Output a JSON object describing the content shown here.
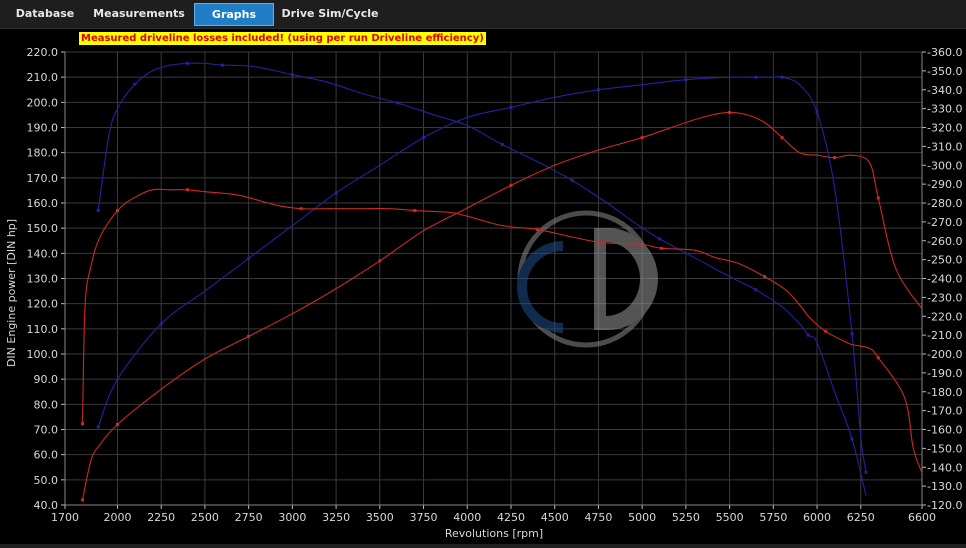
{
  "tabs": [
    {
      "label": "Database",
      "active": false
    },
    {
      "label": "Measurements",
      "active": false
    },
    {
      "label": "Graphs",
      "active": true
    },
    {
      "label": "Drive Sim/Cycle",
      "active": false
    }
  ],
  "banner": "Measured driveline losses included! (using per run Driveline efficiency)",
  "colors": {
    "blue": "#2323a0",
    "red": "#cc2a22",
    "grid": "#3a3a3a",
    "text": "#d8d8d8",
    "accent": "#1f7ec6"
  },
  "chart_data": {
    "type": "line",
    "xlabel": "Revolutions [rpm]",
    "ylabel": "DIN Engine power [DIN hp]",
    "xlim": [
      1700,
      6600
    ],
    "ylim": [
      40,
      220
    ],
    "y2lim": [
      120,
      360
    ],
    "grid": true,
    "x_tick_labels": [
      "1700",
      "2000",
      "2250",
      "2500",
      "2750",
      "3000",
      "3250",
      "3500",
      "3750",
      "4000",
      "4250",
      "4500",
      "4750",
      "5000",
      "5250",
      "5500",
      "5750",
      "6000",
      "6250",
      "6600"
    ],
    "y_tick_labels": [
      "40.0",
      "50.0",
      "60.0",
      "70.0",
      "80.0",
      "90.0",
      "100.0",
      "110.0",
      "120.0",
      "130.0",
      "140.0",
      "150.0",
      "160.0",
      "170.0",
      "180.0",
      "190.0",
      "200.0",
      "210.0",
      "220.0"
    ],
    "y2_tick_labels": [
      "-120.0",
      "-130.0",
      "-140.0",
      "-150.0",
      "-160.0",
      "-170.0",
      "-180.0",
      "-190.0",
      "-200.0",
      "-210.0",
      "-220.0",
      "-230.0",
      "-240.0",
      "-250.0",
      "-260.0",
      "-270.0",
      "-280.0",
      "-290.0",
      "-300.0",
      "-310.0",
      "-320.0",
      "-330.0",
      "-340.0",
      "-350.0",
      "-360.0"
    ],
    "series": [
      {
        "axis": "right",
        "color": "#2323a0",
        "x": [
          1890,
          1950,
          2000,
          2100,
          2200,
          2300,
          2400,
          2450,
          2500,
          2600,
          2650,
          2800,
          3000,
          3200,
          3400,
          3600,
          3800,
          4000,
          4200,
          4400,
          4520,
          4600,
          4800,
          4950,
          5100,
          5300,
          5500,
          5650,
          5800,
          5900,
          5950,
          6000,
          6100,
          6200,
          6280
        ],
        "y": [
          276,
          315,
          330,
          343,
          350,
          353,
          354,
          354,
          354,
          353,
          353,
          352,
          348,
          344,
          338,
          333,
          327,
          321,
          311,
          302,
          296,
          292,
          280,
          270,
          261,
          251,
          241,
          234,
          225,
          216,
          210,
          206,
          180,
          155,
          125
        ]
      },
      {
        "axis": "left",
        "color": "#2323a0",
        "x": [
          1890,
          2000,
          2250,
          2500,
          2750,
          3000,
          3250,
          3500,
          3750,
          4000,
          4250,
          4500,
          4750,
          5000,
          5250,
          5500,
          5650,
          5750,
          5800,
          5900,
          6000,
          6100,
          6200,
          6250,
          6280
        ],
        "y": [
          71,
          90,
          112,
          125,
          138,
          151,
          164,
          175,
          186,
          194,
          198,
          202,
          205,
          207,
          209,
          210,
          210,
          210,
          210,
          207,
          196,
          166,
          108,
          67,
          53
        ]
      },
      {
        "axis": "right",
        "color": "#cc2a22",
        "x": [
          1800,
          1815,
          1850,
          1900,
          2000,
          2100,
          2200,
          2300,
          2400,
          2500,
          2700,
          2900,
          3050,
          3200,
          3400,
          3560,
          3700,
          3900,
          4000,
          4200,
          4400,
          4600,
          4770,
          5000,
          5110,
          5300,
          5420,
          5550,
          5700,
          5820,
          5900,
          5960,
          6050,
          6150,
          6200,
          6300,
          6350,
          6500,
          6550,
          6600
        ],
        "y": [
          163,
          226,
          247,
          262,
          276,
          283,
          287,
          287,
          287,
          286,
          284,
          279,
          277,
          277,
          277,
          277,
          276,
          275,
          273,
          268,
          266,
          262,
          259,
          258,
          256,
          255,
          251,
          248,
          241,
          234,
          226,
          219,
          212,
          207,
          205,
          203,
          198,
          177,
          150,
          137
        ]
      },
      {
        "axis": "left",
        "color": "#cc2a22",
        "x": [
          1800,
          1850,
          1900,
          2000,
          2250,
          2500,
          2750,
          3000,
          3250,
          3500,
          3750,
          4000,
          4250,
          4500,
          4750,
          5000,
          5250,
          5400,
          5500,
          5600,
          5700,
          5800,
          5900,
          6000,
          6100,
          6200,
          6300,
          6350,
          6450,
          6600
        ],
        "y": [
          42,
          58,
          64,
          72,
          86,
          98,
          107,
          116,
          126,
          137,
          149,
          158,
          167,
          175,
          181,
          186,
          192,
          195,
          196,
          195,
          192,
          186,
          180,
          179,
          178,
          179,
          176,
          162,
          134,
          118
        ]
      }
    ]
  }
}
